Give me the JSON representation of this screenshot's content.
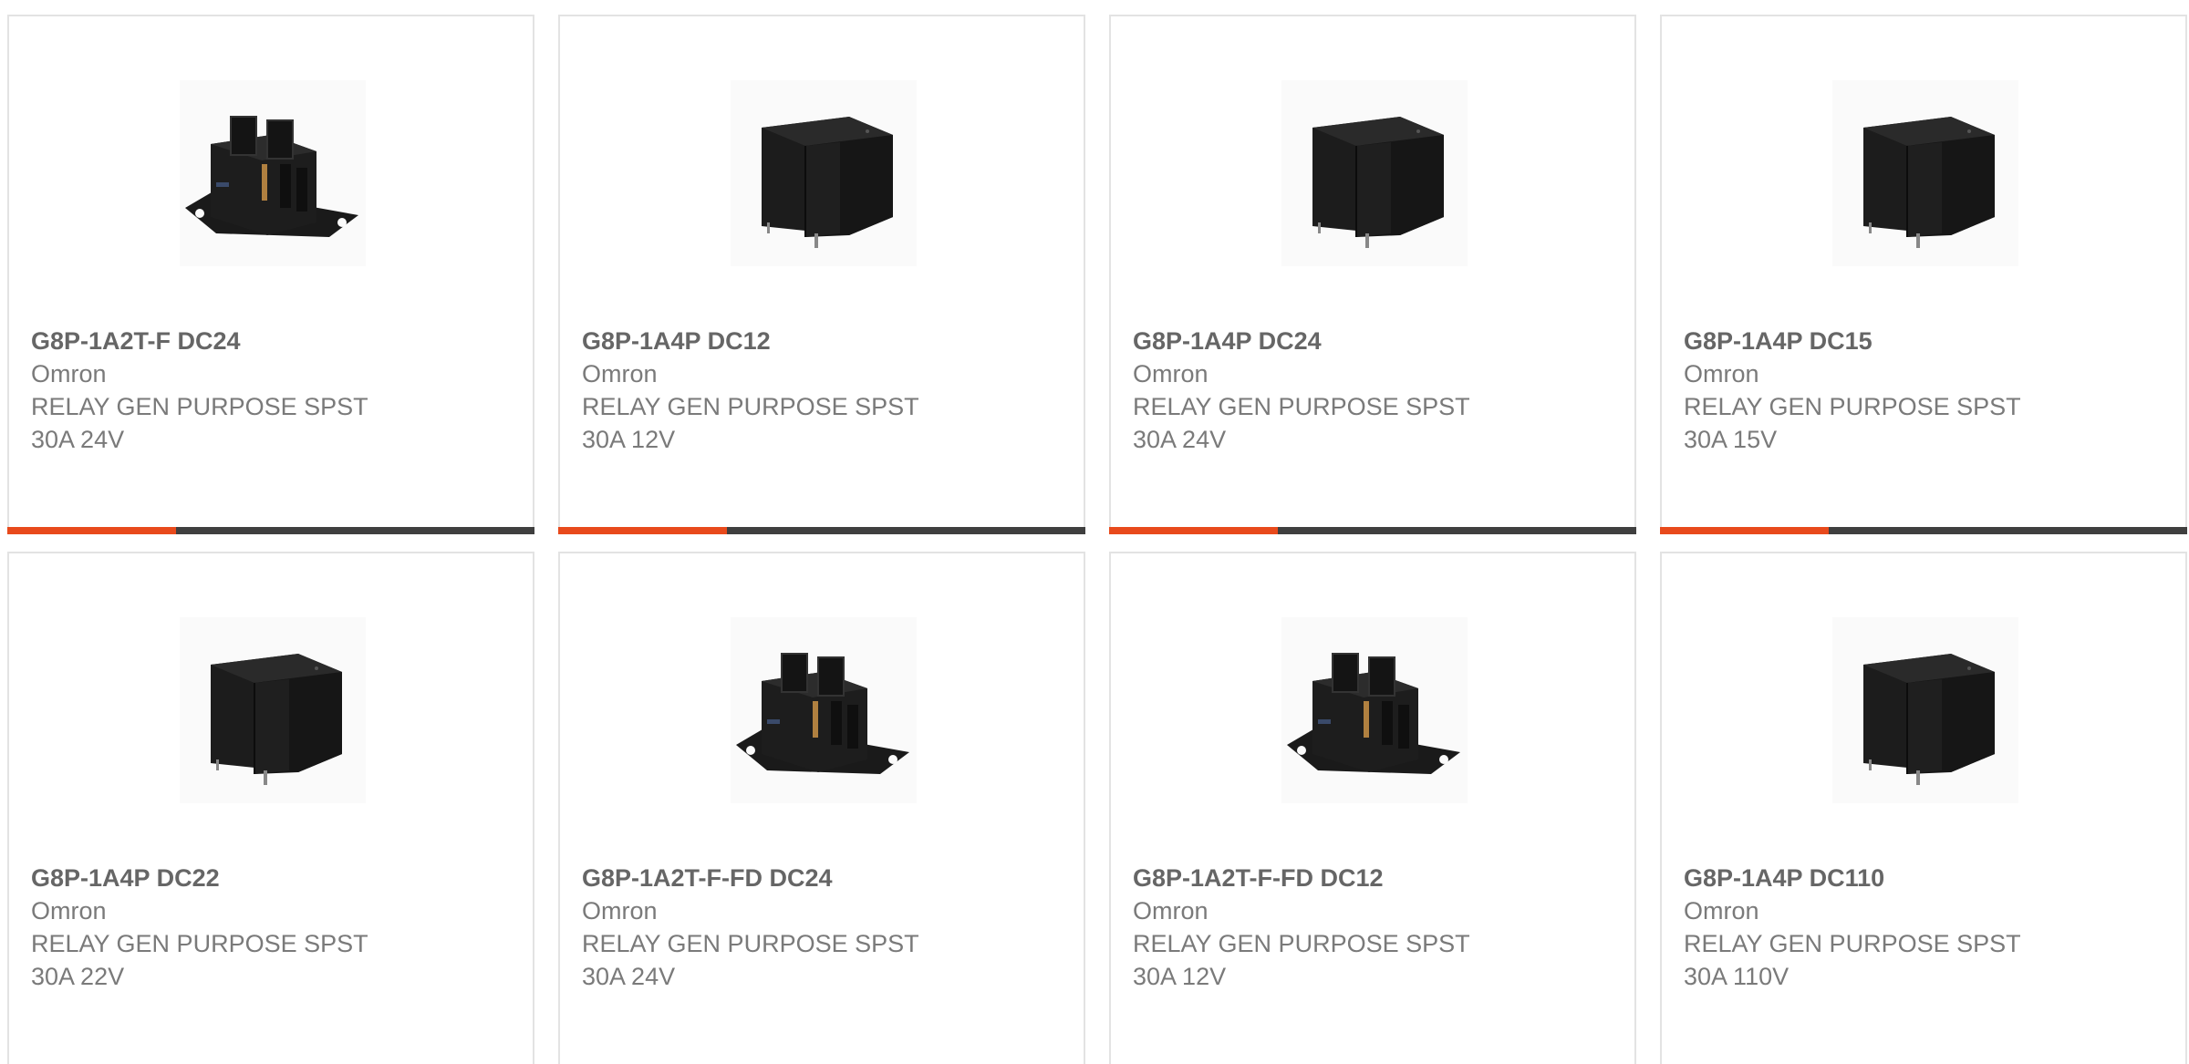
{
  "colors": {
    "accent": "#e84a1c",
    "bar_track": "#3f3f3f",
    "card_border": "#e3e3e3",
    "text": "#7a7a7a"
  },
  "products": [
    {
      "part_number": "G8P-1A2T-F DC24",
      "manufacturer": "Omron",
      "description": "RELAY GEN PURPOSE SPST 30A 24V",
      "image": "relay-quick-connect-flange",
      "progress": 0.32
    },
    {
      "part_number": "G8P-1A4P DC12",
      "manufacturer": "Omron",
      "description": "RELAY GEN PURPOSE SPST 30A 12V",
      "image": "relay-pcb-box",
      "progress": 0.32
    },
    {
      "part_number": "G8P-1A4P DC24",
      "manufacturer": "Omron",
      "description": "RELAY GEN PURPOSE SPST 30A 24V",
      "image": "relay-pcb-box",
      "progress": 0.32
    },
    {
      "part_number": "G8P-1A4P DC15",
      "manufacturer": "Omron",
      "description": "RELAY GEN PURPOSE SPST 30A 15V",
      "image": "relay-pcb-box",
      "progress": 0.32
    },
    {
      "part_number": "G8P-1A4P DC22",
      "manufacturer": "Omron",
      "description": "RELAY GEN PURPOSE SPST 30A 22V",
      "image": "relay-pcb-box"
    },
    {
      "part_number": "G8P-1A2T-F-FD DC24",
      "manufacturer": "Omron",
      "description": "RELAY GEN PURPOSE SPST 30A 24V",
      "image": "relay-quick-connect-flange"
    },
    {
      "part_number": "G8P-1A2T-F-FD DC12",
      "manufacturer": "Omron",
      "description": "RELAY GEN PURPOSE SPST 30A 12V",
      "image": "relay-quick-connect-flange"
    },
    {
      "part_number": "G8P-1A4P DC110",
      "manufacturer": "Omron",
      "description": "RELAY GEN PURPOSE SPST 30A 110V",
      "image": "relay-pcb-box"
    }
  ]
}
